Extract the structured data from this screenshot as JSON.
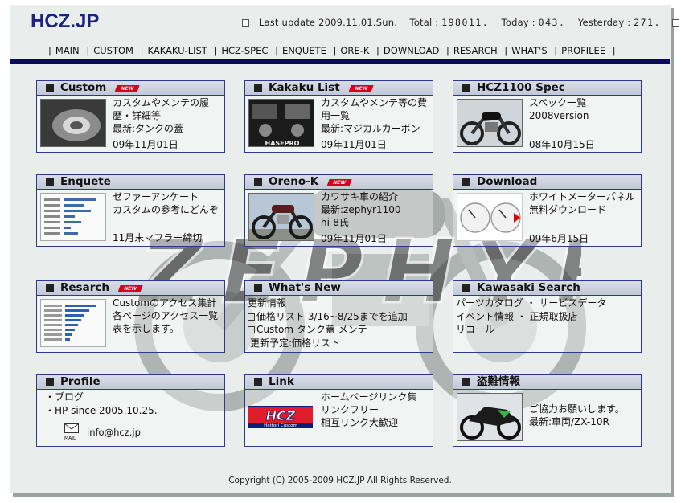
{
  "header": {
    "logo": "HCZ.JP",
    "last_update_label": "Last update",
    "last_update": "2009.11.01.Sun.",
    "total_label": "Total :",
    "total": "198011.",
    "today_label": "Today :",
    "today": "043.",
    "yesterday_label": "Yesterday :",
    "yesterday": "271."
  },
  "nav": [
    "MAIN",
    "CUSTOM",
    "KAKAKU-LIST",
    "HCZ-SPEC",
    "ENQUETE",
    "ORE-K",
    "DOWNLOAD",
    "RESARCH",
    "WHAT'S",
    "PROFILEE"
  ],
  "watermark": {
    "text": "ZEPHYR"
  },
  "panels": {
    "custom": {
      "title": "Custom",
      "new_badge": "NEW",
      "lines": [
        "カスタムやメンテの履",
        "歴・詳細等",
        "最新:タンクの蓋"
      ],
      "date": "09年11月01日",
      "icon": "custom-bike-thumbnail"
    },
    "kakaku": {
      "title": "Kakaku List",
      "new_badge": "NEW",
      "lines": [
        "カスタムやメンテ等の費",
        "用一覧",
        "最新:マジカルカーボン"
      ],
      "date": "09年11月01日",
      "thumb_text": "HASEPRO",
      "icon": "carbon-parts-thumbnail"
    },
    "spec": {
      "title": "HCZ1100 Spec",
      "lines": [
        "スペック一覧",
        "2008version"
      ],
      "date": "08年10月15日",
      "icon": "zephyr-bike-thumbnail"
    },
    "enquete": {
      "title": "Enquete",
      "lines": [
        "ゼファーアンケート",
        "カスタムの参考にどんぞ"
      ],
      "extra": "11月末マフラー締切",
      "icon": "survey-chart-thumbnail"
    },
    "orenok": {
      "title": "Oreno-K",
      "new_badge": "NEW",
      "lines": [
        "カワサキ車の紹介",
        "最新:zephyr1100",
        "hi-8氏"
      ],
      "date": "09年11月01日",
      "icon": "kawasaki-bike-thumbnail"
    },
    "download": {
      "title": "Download",
      "lines": [
        "ホワイトメーターパネル",
        "無料ダウンロード"
      ],
      "date": "09年6月15日",
      "icon": "meter-panel-thumbnail"
    },
    "resarch": {
      "title": "Resarch",
      "new_badge": "NEW",
      "lines": [
        "Customのアクセス集計",
        "各ページのアクセス一覧",
        "表を示します。"
      ],
      "icon": "access-table-thumbnail"
    },
    "whatsnew": {
      "title": "What's New",
      "lines": [
        "更新情報",
        "価格リスト 3/16~8/25までを追加",
        "Custom タンク蓋 メンテ",
        "更新予定:価格リスト"
      ]
    },
    "kawasaki": {
      "title": "Kawasaki Search",
      "lines": [
        "パーツカタログ ・ サービスデータ",
        "イベント情報 ・ 正規取扱店",
        "リコール"
      ]
    },
    "profile": {
      "title": "Profile",
      "lines": [
        "・ブログ",
        "・HP since 2005.10.25."
      ],
      "mail_label": "MAIL",
      "email": "info@hcz.jp",
      "icon": "mail-icon"
    },
    "link": {
      "title": "Link",
      "lines": [
        "ホームページリンク集",
        "リンクフリー",
        "相互リンク大歓迎"
      ],
      "banner_text": "HCZ",
      "banner_sub": "Hattori Custom",
      "icon": "hcz-banner"
    },
    "theft": {
      "title": "盗難情報",
      "lines": [
        "ご協力お願いします。",
        "最新:車両/ZX-10R"
      ],
      "icon": "zx10r-bike-thumbnail"
    }
  },
  "footer": {
    "copyright": "Copyright (C) 2005-2009 HCZ.JP All Rights Reserved."
  },
  "colors": {
    "logo": "#1a237e",
    "panel_border": "#2b3a8a",
    "nav_bar": "#0a0a5e",
    "background": "#e9eeec",
    "new_badge": "#d6001c"
  }
}
